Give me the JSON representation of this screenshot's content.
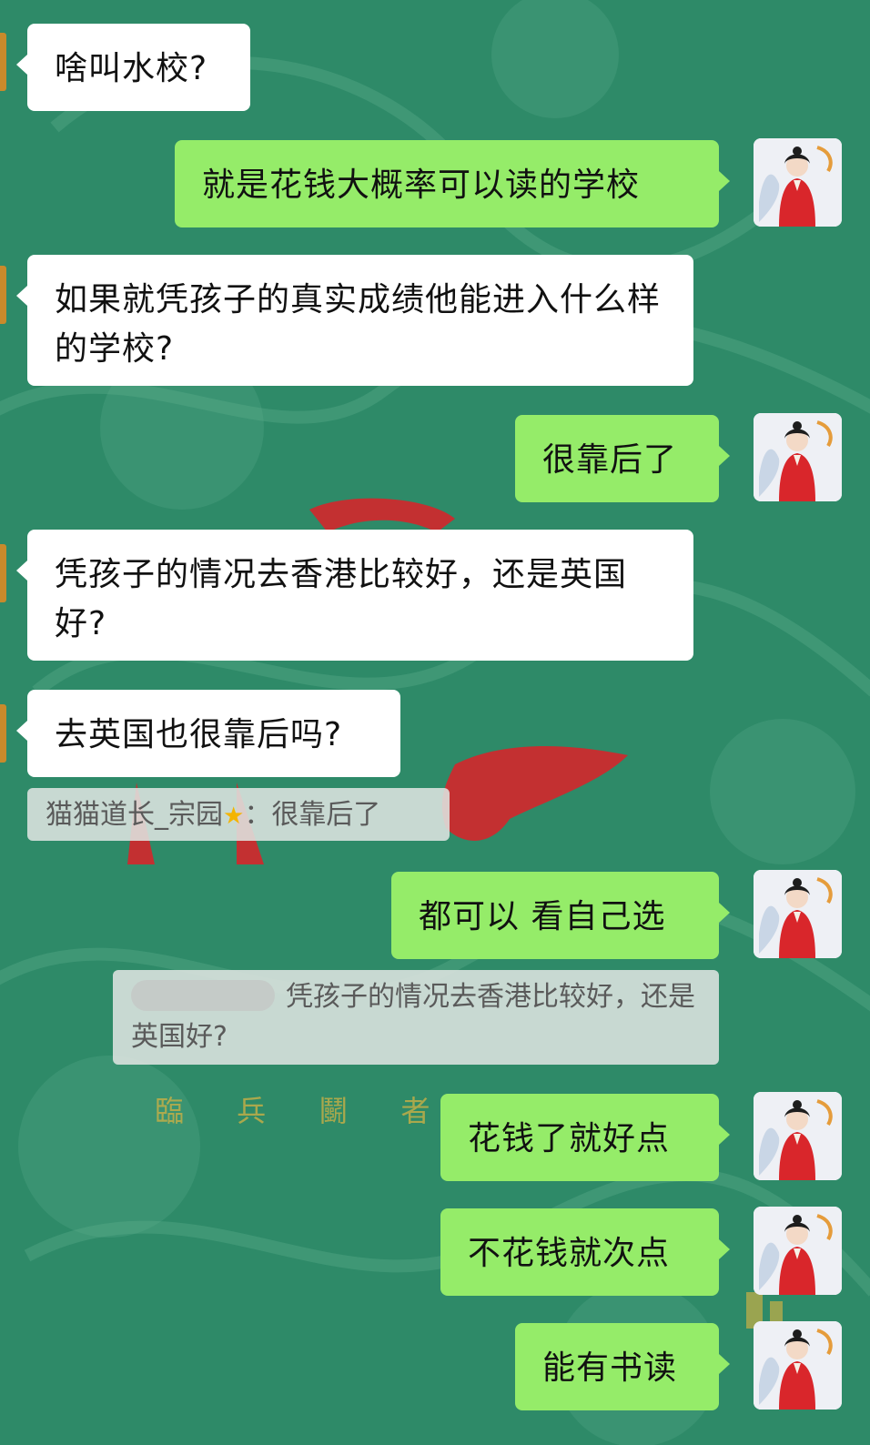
{
  "background": {
    "base_color": "#2e8a68",
    "decor_text": "臨 兵 鬭 者 皆 陣"
  },
  "messages": [
    {
      "side": "in",
      "text": "啥叫水校?"
    },
    {
      "side": "out",
      "text": "就是花钱大概率可以读的学校"
    },
    {
      "side": "in",
      "text": "如果就凭孩子的真实成绩他能进入什么样的学校?"
    },
    {
      "side": "out",
      "text": "很靠后了"
    },
    {
      "side": "in",
      "text": "凭孩子的情况去香港比较好，还是英国好?"
    },
    {
      "side": "in",
      "text": "去英国也很靠后吗?"
    },
    {
      "side": "out",
      "text": "都可以 看自己选"
    },
    {
      "side": "out",
      "text": "花钱了就好点"
    },
    {
      "side": "out",
      "text": "不花钱就次点"
    },
    {
      "side": "out",
      "text": "能有书读"
    }
  ],
  "quotes": [
    {
      "sender": "猫猫道长_宗园",
      "sender_badge": "star-icon",
      "separator": "：",
      "text": "很靠后了"
    },
    {
      "sender": "",
      "sender_blurred": true,
      "text": "凭孩子的情况去香港比较好，还是英国好?"
    }
  ],
  "avatar": {
    "icon": "woman-in-red-hanfu-avatar"
  },
  "colors": {
    "incoming_bubble": "#ffffff",
    "outgoing_bubble": "#95ec69",
    "quote_bg": "#dee4e0"
  }
}
